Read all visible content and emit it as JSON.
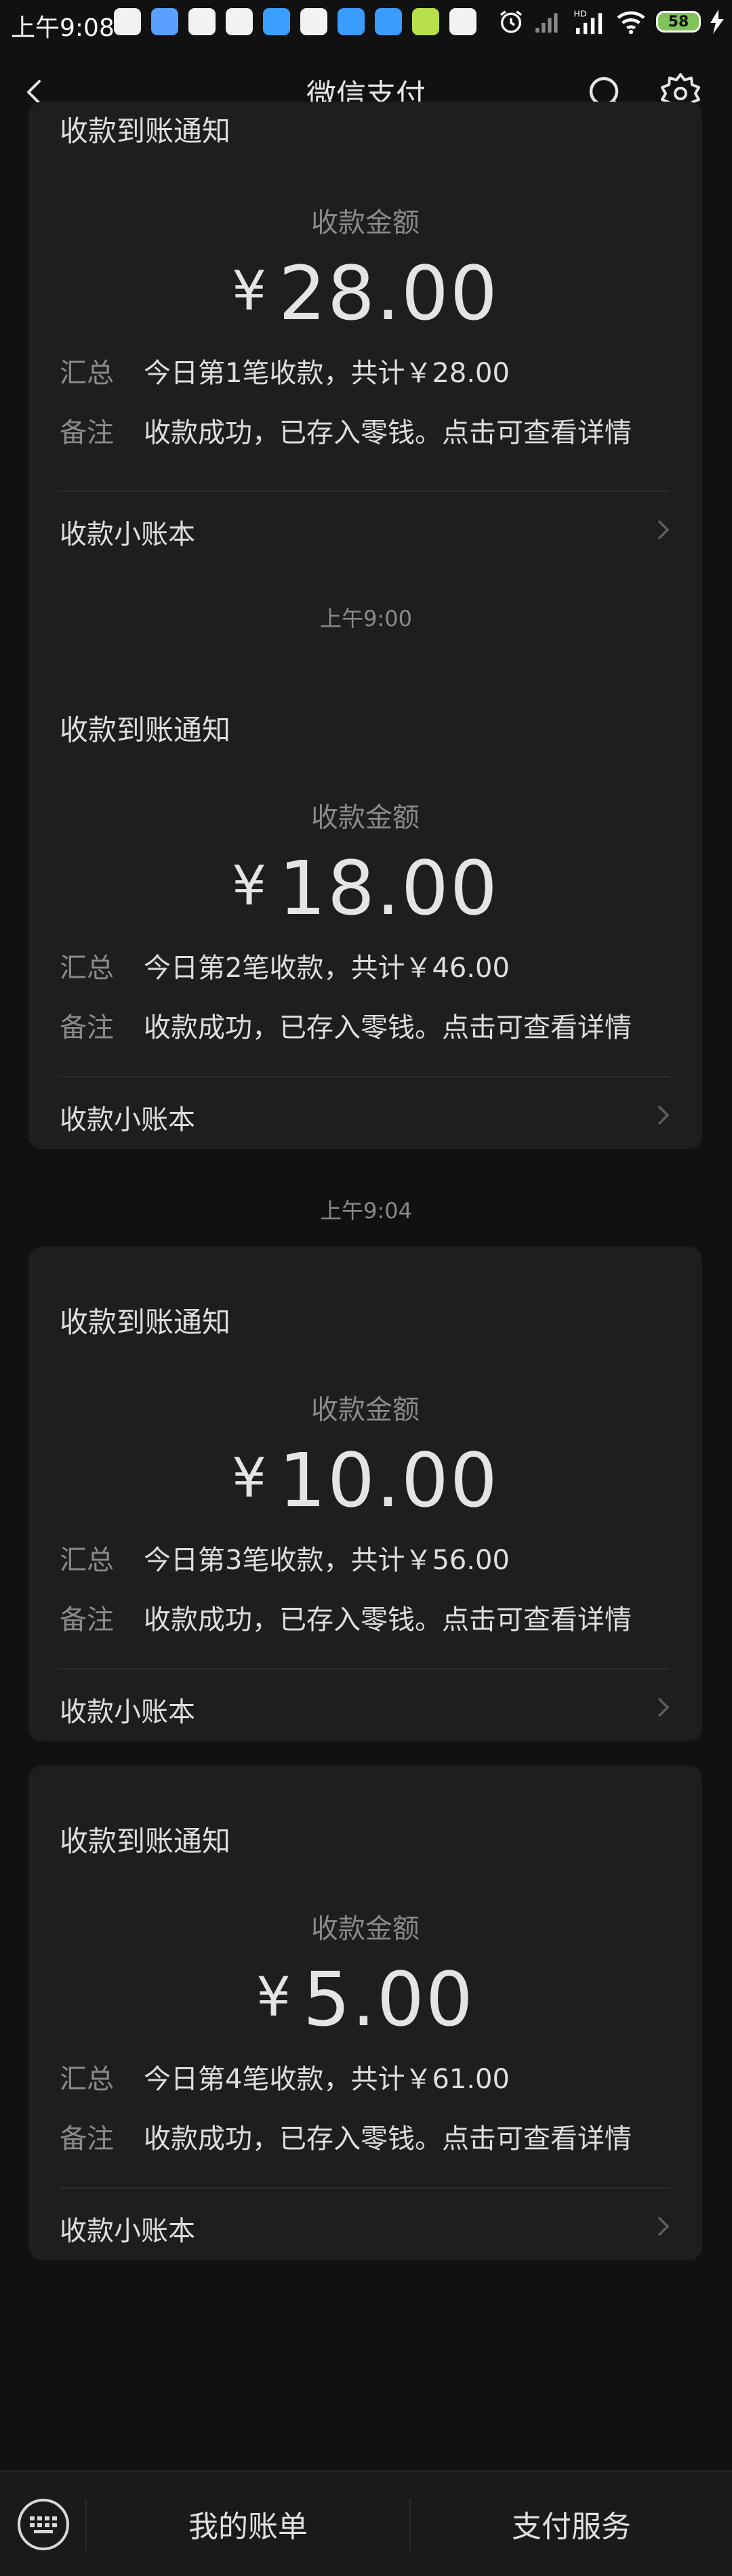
{
  "status_bar": {
    "time": "上午9:08",
    "battery": "58",
    "app_colors": [
      "#f2f2f2",
      "#5aa0ff",
      "#f2f2f2",
      "#f2f2f2",
      "#3aa0ff",
      "#f2f2f2",
      "#3a9cff",
      "#3a9cff",
      "#b8e04a",
      "#f2f2f2"
    ]
  },
  "nav": {
    "title": "微信支付",
    "back_icon": "chevron-left-icon",
    "search_icon": "search-icon",
    "settings_icon": "gear-icon"
  },
  "cards": [
    {
      "title": "收款到账通知",
      "amount_label": "收款金额",
      "currency": "¥",
      "amount": "28.00",
      "summary_key": "汇总",
      "summary": "今日第1笔收款，共计￥28.00",
      "note_key": "备注",
      "note": "收款成功，已存入零钱。点击可查看详情",
      "footer": "收款小账本"
    },
    {
      "timestamp": "上午9:00",
      "title": "收款到账通知",
      "amount_label": "收款金额",
      "currency": "¥",
      "amount": "18.00",
      "summary_key": "汇总",
      "summary": "今日第2笔收款，共计￥46.00",
      "note_key": "备注",
      "note": "收款成功，已存入零钱。点击可查看详情",
      "footer": "收款小账本"
    },
    {
      "timestamp": "上午9:04",
      "title": "收款到账通知",
      "amount_label": "收款金额",
      "currency": "¥",
      "amount": "10.00",
      "summary_key": "汇总",
      "summary": "今日第3笔收款，共计￥56.00",
      "note_key": "备注",
      "note": "收款成功，已存入零钱。点击可查看详情",
      "footer": "收款小账本"
    },
    {
      "title": "收款到账通知",
      "amount_label": "收款金额",
      "currency": "¥",
      "amount": "5.00",
      "summary_key": "汇总",
      "summary": "今日第4笔收款，共计￥61.00",
      "note_key": "备注",
      "note": "收款成功，已存入零钱。点击可查看详情",
      "footer": "收款小账本"
    }
  ],
  "bottom_bar": {
    "keyboard_icon": "keyboard-icon",
    "bills": "我的账单",
    "services": "支付服务"
  }
}
